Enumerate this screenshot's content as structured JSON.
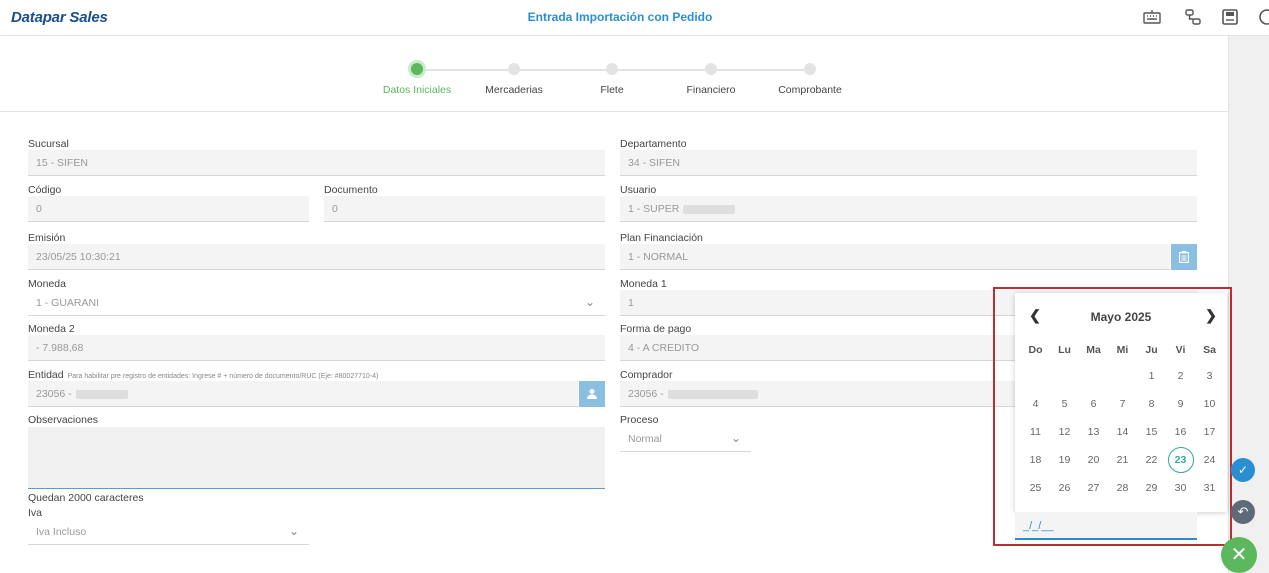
{
  "header": {
    "brand": "Datapar Sales",
    "title": "Entrada Importación con Pedido",
    "icons": [
      "keyboard-icon",
      "network-icon",
      "save-icon",
      "help-icon"
    ]
  },
  "steps": [
    {
      "label": "Datos Iniciales",
      "active": true
    },
    {
      "label": "Mercaderias",
      "active": false
    },
    {
      "label": "Flete",
      "active": false
    },
    {
      "label": "Financiero",
      "active": false
    },
    {
      "label": "Comprobante",
      "active": false
    }
  ],
  "form": {
    "sucursal": {
      "label": "Sucursal",
      "value": "15 - SIFEN"
    },
    "departamento": {
      "label": "Departamento",
      "value": "34 - SIFEN"
    },
    "codigo": {
      "label": "Código",
      "value": "0"
    },
    "documento": {
      "label": "Documento",
      "value": "0"
    },
    "usuario": {
      "label": "Usuario",
      "value": "1 - SUPER"
    },
    "emision": {
      "label": "Emisión",
      "value": "23/05/25 10:30:21"
    },
    "plan": {
      "label": "Plan Financiación",
      "value": "1 - NORMAL"
    },
    "moneda": {
      "label": "Moneda",
      "value": "1 - GUARANI"
    },
    "moneda1": {
      "label": "Moneda 1",
      "value": "1"
    },
    "moneda2": {
      "label": "Moneda 2",
      "value": "- 7.988,68"
    },
    "forma_pago": {
      "label": "Forma de pago",
      "value": "4 - A CREDITO"
    },
    "entidad": {
      "label": "Entidad",
      "hint": "Para habilitar pre registro de entidades: Ingrese # + número de documento/RUC (Eje: #80027710-4)",
      "value": "23056 -"
    },
    "comprador": {
      "label": "Comprador",
      "value": "23056 -"
    },
    "observaciones": {
      "label": "Observaciones",
      "counter": "Quedan 2000 caracteres"
    },
    "proceso": {
      "label": "Proceso",
      "value": "Normal"
    },
    "iva": {
      "label": "Iva",
      "value": "Iva Incluso"
    }
  },
  "calendar": {
    "month": "Mayo 2025",
    "weekdays": [
      "Do",
      "Lu",
      "Ma",
      "Mi",
      "Ju",
      "Vi",
      "Sa"
    ],
    "weeks": [
      [
        "",
        "",
        "",
        "",
        "1",
        "2",
        "3"
      ],
      [
        "4",
        "5",
        "6",
        "7",
        "8",
        "9",
        "10"
      ],
      [
        "11",
        "12",
        "13",
        "14",
        "15",
        "16",
        "17"
      ],
      [
        "18",
        "19",
        "20",
        "21",
        "22",
        "23",
        "24"
      ],
      [
        "25",
        "26",
        "27",
        "28",
        "29",
        "30",
        "31"
      ]
    ],
    "today": "23",
    "input_value": "_/_/__"
  },
  "colors": {
    "accent": "#2a8fd2",
    "success": "#5cb85c",
    "close": "#5cb85c",
    "highlight": "#b73131"
  }
}
